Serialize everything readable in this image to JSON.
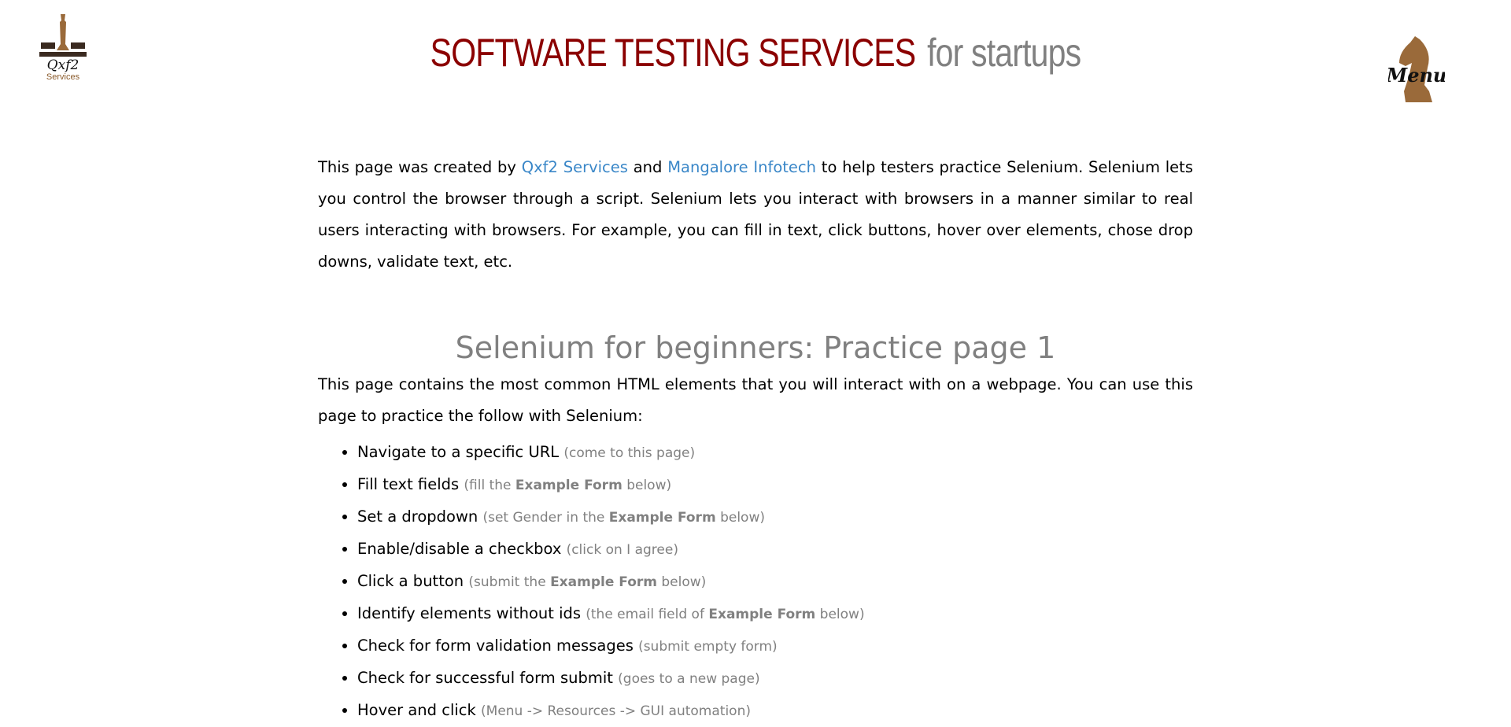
{
  "header": {
    "logo_text": "Qxf2 Services",
    "title_main": "SOFTWARE TESTING SERVICES",
    "title_sub": "for startups",
    "menu_label": "Menu"
  },
  "intro": {
    "prefix": "This page was created by ",
    "link1": "Qxf2 Services",
    "mid": " and ",
    "link2": "Mangalore Infotech",
    "suffix": " to help testers practice Selenium. Selenium lets you control the browser through a script. Selenium lets you interact with browsers in a manner similar to real users interacting with browsers. For example, you can fill in text, click buttons, hover over elements, chose drop downs, validate text, etc."
  },
  "section": {
    "heading": "Selenium for beginners: Practice page 1",
    "description": "This page contains the most common HTML elements that you will interact with on a webpage. You can use this page to practice the follow with Selenium:"
  },
  "items": [
    {
      "text": "Navigate to a specific URL",
      "hint_pre": "(come to this page)",
      "bold": "",
      "hint_post": ""
    },
    {
      "text": "Fill text fields",
      "hint_pre": "(fill the ",
      "bold": "Example Form",
      "hint_post": " below)"
    },
    {
      "text": "Set a dropdown",
      "hint_pre": "(set Gender in the ",
      "bold": "Example Form",
      "hint_post": " below)"
    },
    {
      "text": "Enable/disable a checkbox",
      "hint_pre": "(click on I agree)",
      "bold": "",
      "hint_post": ""
    },
    {
      "text": "Click a button",
      "hint_pre": "(submit the ",
      "bold": "Example Form",
      "hint_post": " below)"
    },
    {
      "text": "Identify elements without ids",
      "hint_pre": "(the email field of ",
      "bold": "Example Form",
      "hint_post": " below)"
    },
    {
      "text": "Check for form validation messages",
      "hint_pre": "(submit empty form)",
      "bold": "",
      "hint_post": ""
    },
    {
      "text": "Check for successful form submit",
      "hint_pre": "(goes to a new page)",
      "bold": "",
      "hint_post": ""
    },
    {
      "text": "Hover and click",
      "hint_pre": "(Menu -> Resources -> GUI automation)",
      "bold": "",
      "hint_post": ""
    }
  ]
}
